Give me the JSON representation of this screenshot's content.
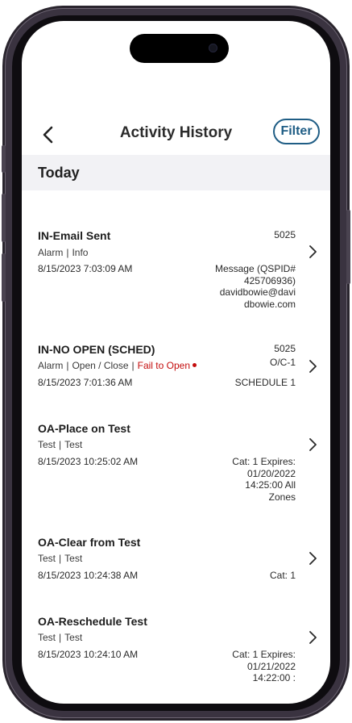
{
  "header": {
    "title": "Activity History",
    "filter_label": "Filter"
  },
  "section": {
    "label": "Today"
  },
  "activities": [
    {
      "title": "IN-Email Sent",
      "tags": [
        "Alarm",
        "Info"
      ],
      "timestamp": "8/15/2023 7:03:09 AM",
      "code": "5025",
      "detail": "Message (QSPID#\n425706936)\ndavidbowie@davi\ndbowie.com"
    },
    {
      "title": "IN-NO OPEN (SCHED)",
      "tags": [
        "Alarm",
        "Open / Close"
      ],
      "status": "Fail to Open",
      "status_color": "#c40d0d",
      "timestamp": "8/15/2023 7:01:36 AM",
      "code": "5025",
      "zone": "O/C-1",
      "detail": "SCHEDULE 1"
    },
    {
      "title": "OA-Place on Test",
      "tags": [
        "Test",
        "Test"
      ],
      "timestamp": "8/15/2023 10:25:02 AM",
      "detail": "Cat: 1 Expires:\n01/20/2022\n14:25:00  All\nZones"
    },
    {
      "title": "OA-Clear from Test",
      "tags": [
        "Test",
        "Test"
      ],
      "timestamp": "8/15/2023 10:24:38 AM",
      "detail": "Cat: 1"
    },
    {
      "title": "OA-Reschedule Test",
      "tags": [
        "Test",
        "Test"
      ],
      "timestamp": "8/15/2023 10:24:10 AM",
      "detail": "Cat: 1 Expires:\n01/21/2022\n14:22:00 :"
    }
  ],
  "icons": {
    "back": "chevron-left-icon",
    "row_action": "chevron-right-icon"
  },
  "colors": {
    "accent": "#1f5d85",
    "section_bg": "#f2f2f5",
    "alert": "#c40d0d"
  }
}
